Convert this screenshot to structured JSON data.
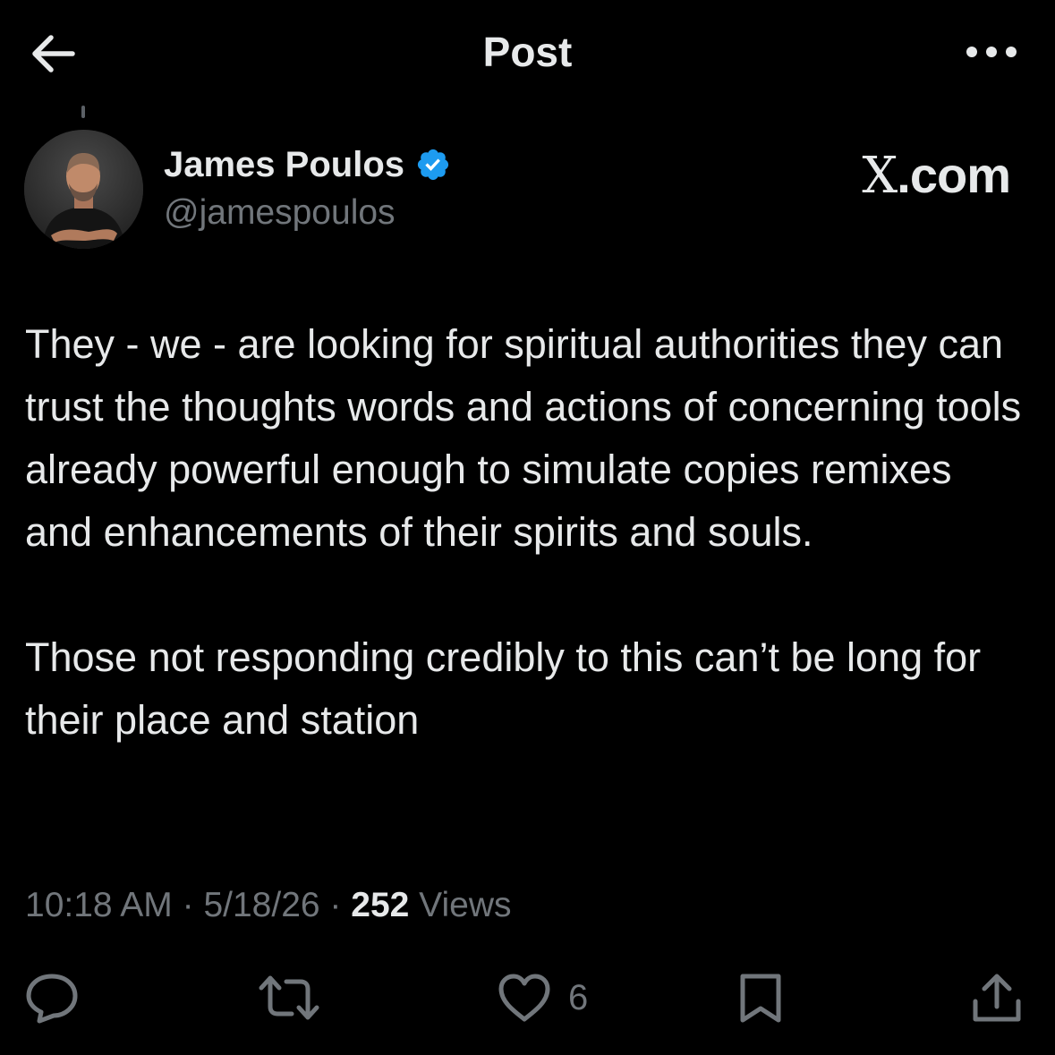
{
  "header": {
    "title": "Post",
    "back_icon": "arrow-left-icon",
    "more_icon": "more-horizontal-icon"
  },
  "author": {
    "name": "James Poulos",
    "handle": "@jamespoulos",
    "verified": true,
    "verified_color": "#1d9bf0"
  },
  "watermark": {
    "logo_glyph": "X",
    "domain": ".com"
  },
  "post": {
    "paragraphs": [
      "They - we - are looking for spiritual authorities they can trust the thoughts words and actions of concerning tools already powerful enough to simulate copies remixes and enhancements of their spirits and souls.",
      "Those not responding credibly to this can’t be long for their place and station"
    ]
  },
  "meta": {
    "time": "10:18 AM",
    "separator": " · ",
    "date": "5/18/26",
    "views_count": "252",
    "views_label": " Views"
  },
  "actions": {
    "reply_icon": "reply-icon",
    "repost_icon": "repost-icon",
    "like_icon": "heart-icon",
    "like_count": "6",
    "bookmark_icon": "bookmark-icon",
    "share_icon": "share-icon"
  },
  "colors": {
    "background": "#000000",
    "text_primary": "#e7e9ea",
    "text_secondary": "#71767b",
    "accent": "#1d9bf0"
  }
}
